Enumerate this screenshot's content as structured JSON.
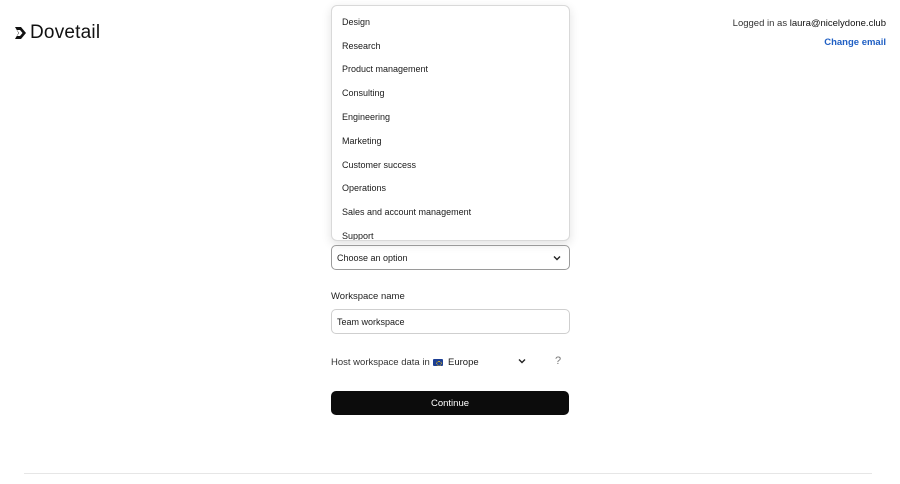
{
  "brand": {
    "name": "Dovetail"
  },
  "account": {
    "logged_in_prefix": "Logged in as",
    "email": "laura@nicelydone.club",
    "change_email_label": "Change email"
  },
  "dropdown": {
    "options": [
      "Design",
      "Research",
      "Product management",
      "Consulting",
      "Engineering",
      "Marketing",
      "Customer success",
      "Operations",
      "Sales and account management",
      "Support"
    ]
  },
  "role_select": {
    "value": "Choose an option"
  },
  "workspace": {
    "label": "Workspace name",
    "value": "Team workspace"
  },
  "hosting": {
    "label": "Host workspace data in",
    "region": "Europe",
    "help_glyph": "?"
  },
  "continue_label": "Continue",
  "colors": {
    "link": "#1f5fc4",
    "button": "#0c0c0c",
    "flag": "#1c3f94"
  }
}
